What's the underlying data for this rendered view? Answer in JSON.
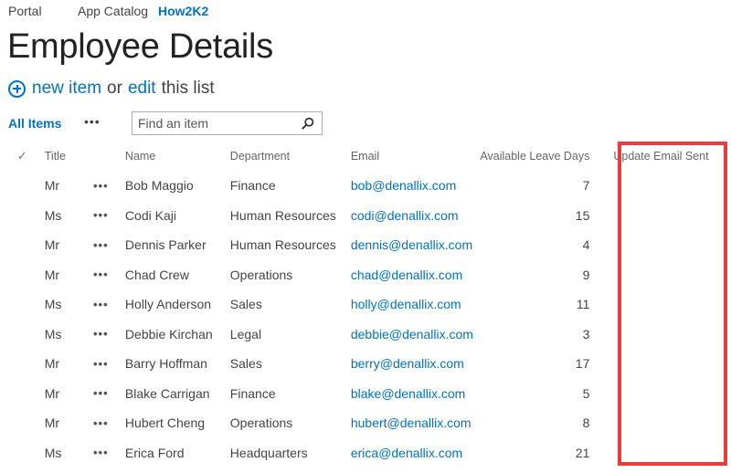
{
  "topnav": [
    "Portal",
    "App Catalog",
    "How2K2"
  ],
  "page_title": "Employee Details",
  "new_item": {
    "new_label": "new item",
    "or_label": "or",
    "edit_label": "edit",
    "rest_label": "this list"
  },
  "view": {
    "all_items_label": "All Items",
    "more_label": "•••"
  },
  "search": {
    "placeholder": "Find an item",
    "value": ""
  },
  "icons": {
    "plus": "plus-circle-icon",
    "search": "magnifier-icon",
    "check": "checkmark-icon",
    "ellipsis": "ellipsis-icon"
  },
  "table": {
    "check_glyph": "✓",
    "row_menu_glyph": "•••",
    "headers": [
      "Title",
      "Name",
      "Department",
      "Email",
      "Available Leave Days",
      "Update Email Sent"
    ],
    "rows": [
      {
        "title": "Mr",
        "name": "Bob Maggio",
        "department": "Finance",
        "email": "bob@denallix.com",
        "leave_days": "7",
        "update_email_sent": ""
      },
      {
        "title": "Ms",
        "name": "Codi Kaji",
        "department": "Human Resources",
        "email": "codi@denallix.com",
        "leave_days": "15",
        "update_email_sent": ""
      },
      {
        "title": "Mr",
        "name": "Dennis Parker",
        "department": "Human Resources",
        "email": "dennis@denallix.com",
        "leave_days": "4",
        "update_email_sent": ""
      },
      {
        "title": "Mr",
        "name": "Chad Crew",
        "department": "Operations",
        "email": "chad@denallix.com",
        "leave_days": "9",
        "update_email_sent": ""
      },
      {
        "title": "Ms",
        "name": "Holly Anderson",
        "department": "Sales",
        "email": "holly@denallix.com",
        "leave_days": "11",
        "update_email_sent": ""
      },
      {
        "title": "Ms",
        "name": "Debbie Kirchan",
        "department": "Legal",
        "email": "debbie@denallix.com",
        "leave_days": "3",
        "update_email_sent": ""
      },
      {
        "title": "Mr",
        "name": "Barry Hoffman",
        "department": "Sales",
        "email": "berry@denallix.com",
        "leave_days": "17",
        "update_email_sent": ""
      },
      {
        "title": "Mr",
        "name": "Blake Carrigan",
        "department": "Finance",
        "email": "blake@denallix.com",
        "leave_days": "5",
        "update_email_sent": ""
      },
      {
        "title": "Mr",
        "name": "Hubert Cheng",
        "department": "Operations",
        "email": "hubert@denallix.com",
        "leave_days": "8",
        "update_email_sent": ""
      },
      {
        "title": "Ms",
        "name": "Erica Ford",
        "department": "Headquarters",
        "email": "erica@denallix.com",
        "leave_days": "21",
        "update_email_sent": ""
      }
    ]
  },
  "colors": {
    "link": "#0072c6",
    "highlight_box": "#f03a3a",
    "text": "#444444"
  }
}
